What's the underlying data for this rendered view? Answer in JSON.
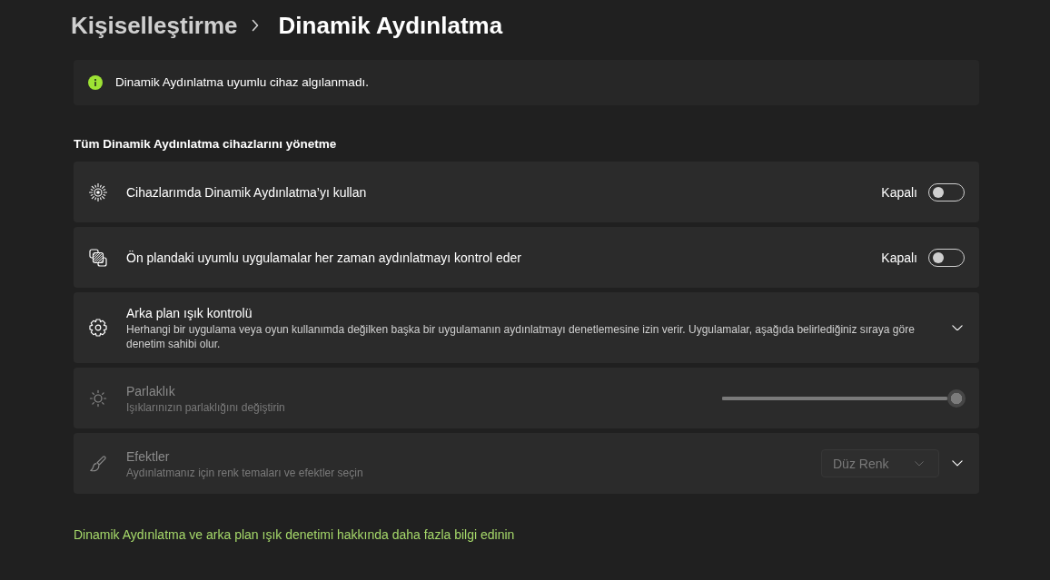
{
  "breadcrumb": [
    {
      "label": "Kişiselleştirme",
      "current": false
    },
    {
      "label": "Dinamik Aydınlatma",
      "current": true
    }
  ],
  "info_bar": {
    "message": "Dinamik Aydınlatma uyumlu cihaz algılanmadı."
  },
  "section": {
    "heading": "Tüm Dinamik Aydınlatma cihazlarını yönetme"
  },
  "settings": [
    {
      "kind": "toggle",
      "title": "Cihazlarımda Dinamik Aydınlatma’yı kullan",
      "state_label": "Kapalı",
      "on": false,
      "disabled": false
    },
    {
      "kind": "toggle",
      "title": "Ön plandaki uyumlu uygulamalar her zaman aydınlatmayı kontrol eder",
      "state_label": "Kapalı",
      "on": false,
      "disabled": false
    },
    {
      "kind": "expander",
      "title": "Arka plan ışık kontrolü",
      "description": "Herhangi bir uygulama veya oyun kullanımda değilken başka bir uygulamanın aydınlatmayı denetlemesine izin verir. Uygulamalar, aşağıda belirlediğiniz sıraya göre denetim sahibi olur.",
      "expanded": false,
      "disabled": false
    },
    {
      "kind": "slider",
      "title": "Parlaklık",
      "description": "Işıklarınızın parlaklığını değiştirin",
      "level": 1,
      "disabled": true
    },
    {
      "kind": "dropdown",
      "title": "Efektler",
      "description": "Aydınlatmanız için renk temaları ve efektler seçin",
      "value": "Düz Renk",
      "expanded": false,
      "disabled": true
    }
  ],
  "link": {
    "text": "Dinamik Aydınlatma ve arka plan ışık denetimi hakkında daha fazla bilgi edinin"
  }
}
